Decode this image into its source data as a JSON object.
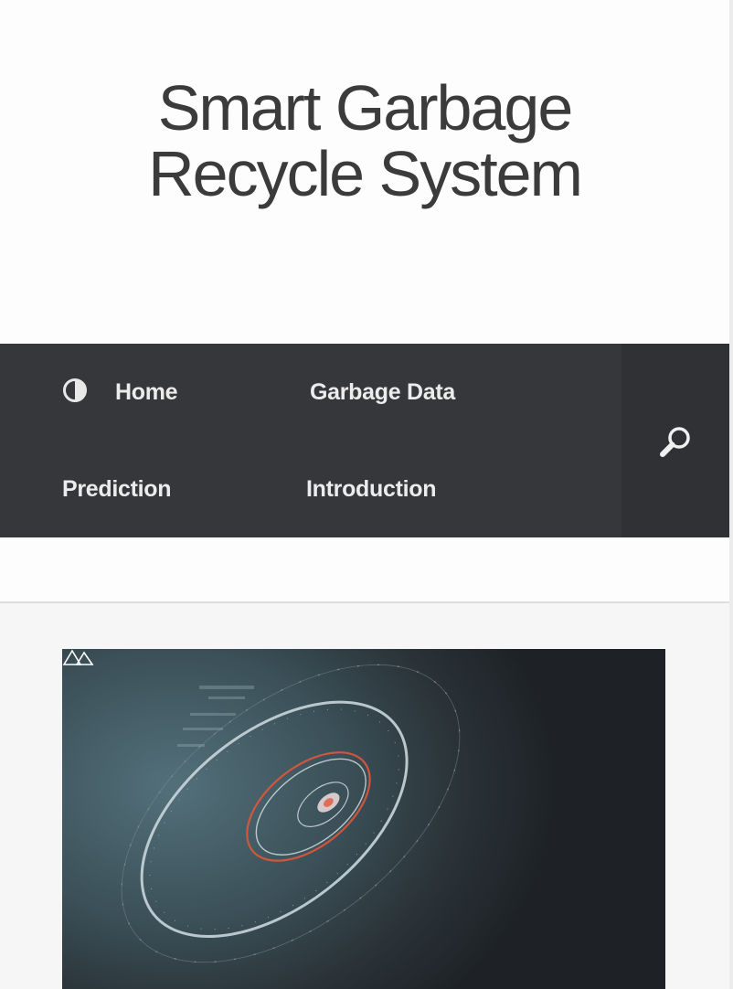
{
  "site": {
    "title_line1": "Smart Garbage",
    "title_line2": "Recycle System"
  },
  "nav": {
    "items": [
      {
        "label": "Home",
        "icon": "half-circle-icon"
      },
      {
        "label": "Garbage Data"
      },
      {
        "label": "Prediction"
      },
      {
        "label": "Introduction"
      }
    ],
    "search_icon": "search-icon"
  },
  "colors": {
    "nav_bg": "#36373b",
    "search_bg": "#303135",
    "nav_text": "#ececec",
    "title_text": "#3b3b3b",
    "hero_accent": "#e0573a"
  },
  "hero": {
    "image": "hud-dial-illustration",
    "logo": "ad-logo"
  }
}
